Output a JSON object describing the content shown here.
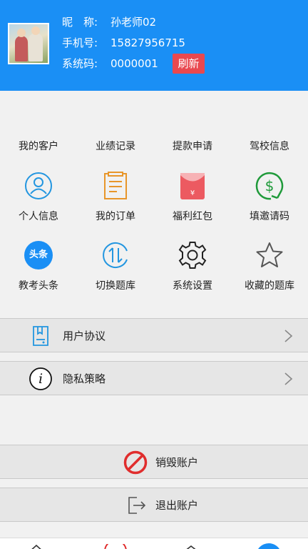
{
  "profile": {
    "nickname_label": "昵　称:",
    "nickname": "孙老师02",
    "phone_label": "手机号:",
    "phone": "15827956715",
    "syscode_label": "系统码:",
    "syscode": "0000001",
    "refresh_label": "刷新"
  },
  "top_links": [
    "我的客户",
    "业绩记录",
    "提款申请",
    "驾校信息"
  ],
  "grid": [
    {
      "label": "个人信息",
      "icon": "user-icon"
    },
    {
      "label": "我的订单",
      "icon": "order-icon"
    },
    {
      "label": "福利红包",
      "icon": "red-envelope-icon"
    },
    {
      "label": "填邀请码",
      "icon": "dollar-icon"
    },
    {
      "label": "教考头条",
      "icon": "headline-icon",
      "badge": "头条"
    },
    {
      "label": "切换题库",
      "icon": "switch-icon"
    },
    {
      "label": "系统设置",
      "icon": "gear-icon"
    },
    {
      "label": "收藏的题库",
      "icon": "star-icon"
    }
  ],
  "list": [
    {
      "label": "用户协议",
      "icon": "document-icon"
    },
    {
      "label": "隐私策略",
      "icon": "info-icon",
      "glyph": "i"
    }
  ],
  "actions": {
    "delete_account": "销毁账户",
    "logout": "退出账户"
  },
  "colors": {
    "header": "#1a8ff5",
    "accent_blue": "#2396e0",
    "orange": "#e8962a",
    "red": "#e9484f",
    "green": "#1f9a3a"
  }
}
